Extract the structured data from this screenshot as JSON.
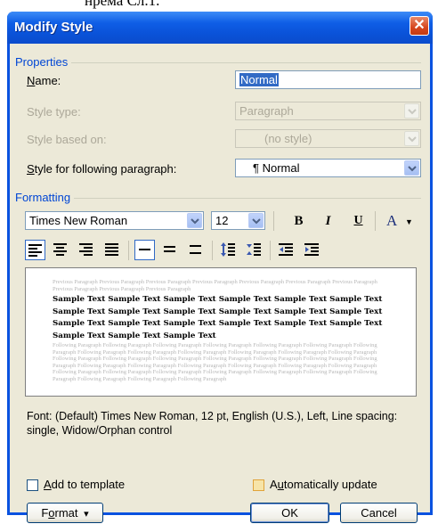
{
  "window": {
    "title": "Modify Style",
    "close_glyph": "✕"
  },
  "top_strip_text": "нрема Сл.1.",
  "properties": {
    "group_label": "Properties",
    "name_label_pre": "",
    "name_label_key": "N",
    "name_label_post": "ame:",
    "name_value": "Normal",
    "style_type_label": "Style type:",
    "style_type_value": "Paragraph",
    "based_on_label": "Style based on:",
    "based_on_value": "(no style)",
    "following_label_key": "S",
    "following_label_post": "tyle for following paragraph:",
    "following_value": "¶ Normal"
  },
  "formatting": {
    "group_label": "Formatting",
    "font": "Times New Roman",
    "size": "12",
    "bold": "B",
    "italic": "I",
    "underline": "U",
    "font_color": "A"
  },
  "preview": {
    "previous_text": "Previous Paragraph Previous Paragraph Previous Paragraph Previous Paragraph Previous Paragraph Previous Paragraph Previous Paragraph Previous Paragraph Previous Paragraph Previous Paragraph",
    "sample_lines": [
      "Sample Text Sample Text Sample Text Sample Text Sample Text Sample Text",
      "Sample Text Sample Text Sample Text Sample Text Sample Text Sample Text",
      "Sample Text Sample Text Sample Text Sample Text Sample Text Sample Text",
      "Sample Text Sample Text Sample Text"
    ],
    "following_text": "Following Paragraph Following Paragraph Following Paragraph Following Paragraph Following Paragraph Following Paragraph Following Paragraph Following Paragraph Following Paragraph Following Paragraph Following Paragraph Following Paragraph Following Paragraph Following Paragraph Following Paragraph Following Paragraph Following Paragraph Following Paragraph Following Paragraph Following Paragraph Following Paragraph Following Paragraph Following Paragraph Following Paragraph Following Paragraph Following Paragraph Following Paragraph Following Paragraph Following Paragraph Following Paragraph Following Paragraph Following Paragraph Following Paragraph Following Paragraph Following Paragraph Following Paragraph"
  },
  "description": "Font: (Default) Times New Roman, 12 pt, English (U.S.), Left, Line spacing:  single, Widow/Orphan control",
  "options": {
    "add_key": "A",
    "add_post": "dd to template",
    "auto_pre": "A",
    "auto_key": "u",
    "auto_post": "tomatically update"
  },
  "buttons": {
    "format_pre": "F",
    "format_key": "o",
    "format_post": "rmat",
    "format_arrow": "▾",
    "ok": "OK",
    "cancel": "Cancel"
  },
  "colors": {
    "title_blue": "#0a52e0",
    "dialog_face": "#ece9d8",
    "group_label": "#0046d5",
    "selection": "#316ac5"
  }
}
